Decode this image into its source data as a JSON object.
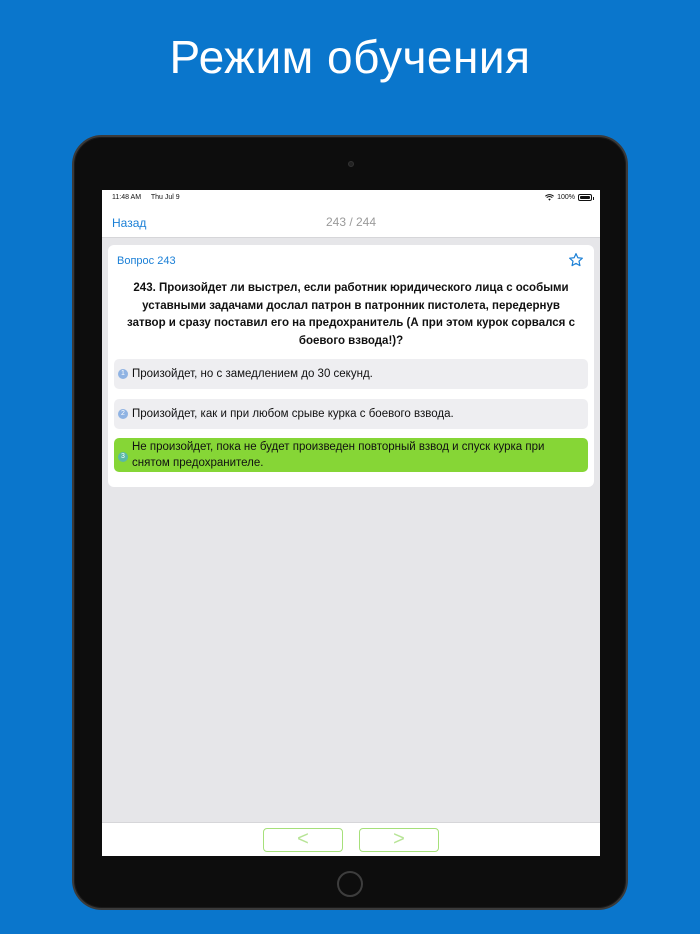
{
  "headline": "Режим обучения",
  "status": {
    "time": "11:48 AM",
    "date": "Thu Jul 9",
    "battery": "100%"
  },
  "nav": {
    "back": "Назад",
    "title": "243 / 244"
  },
  "question": {
    "label": "Вопрос 243",
    "text": "243. Произойдет ли выстрел, если работник юридического лица с особыми уставными задачами дослал патрон в патронник пистолета, передернув затвор и сразу поставил его на предохранитель (А при этом курок сорвался с боевого взвода!)?"
  },
  "answers": [
    {
      "num": "1",
      "text": "Произойдет, но с замедлением до 30 секунд.",
      "correct": false
    },
    {
      "num": "2",
      "text": "Произойдет, как и при любом срыве курка с боевого взвода.",
      "correct": false
    },
    {
      "num": "3",
      "text": "Не произойдет, пока не будет произведен повторный взвод и спуск курка при снятом предохранителе.",
      "correct": true
    }
  ],
  "bottom": {
    "prev": "<",
    "next": ">"
  },
  "colors": {
    "background": "#0a76cc",
    "accent": "#1a7fd6",
    "correct": "#86d636"
  },
  "icons": {
    "favorite": "star-icon",
    "wifi": "wifi-icon",
    "battery": "battery-icon"
  }
}
